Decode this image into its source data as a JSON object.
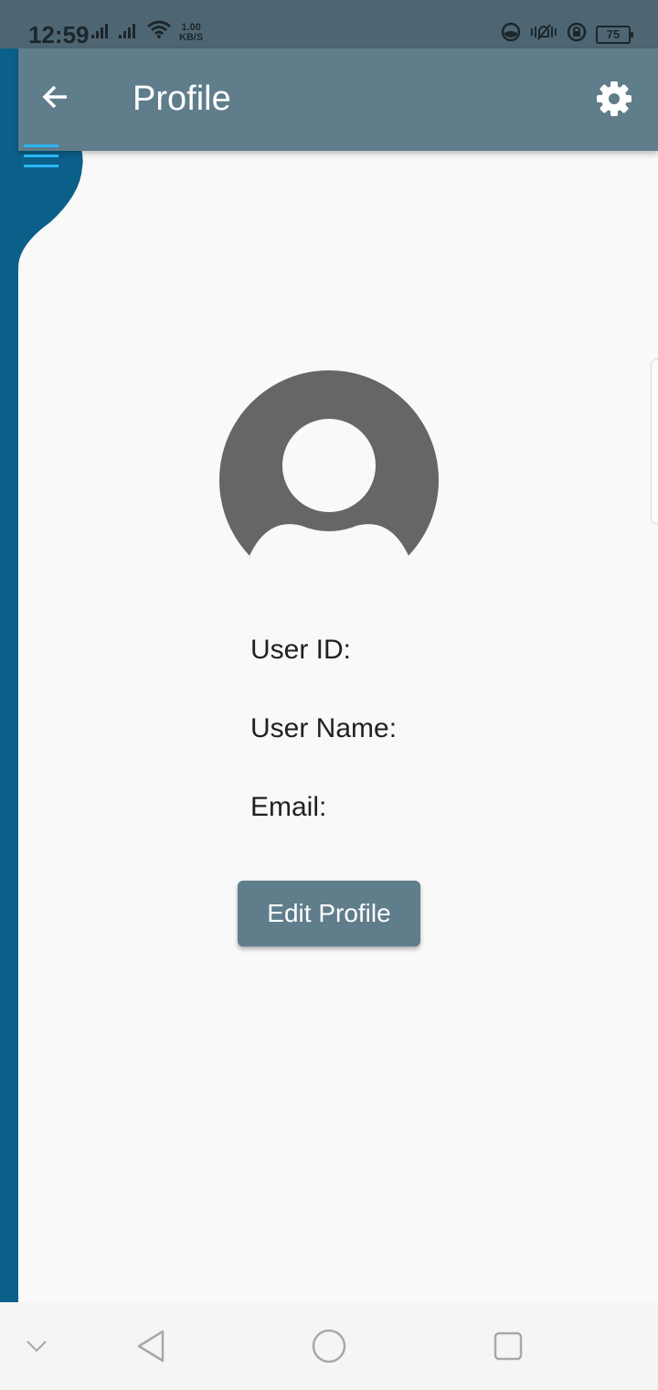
{
  "status_bar": {
    "time": "12:59",
    "net_speed_value": "1.00",
    "net_speed_unit": "KB/S",
    "battery_level": "75",
    "icons": [
      "signal-icon",
      "signal-icon",
      "wifi-icon",
      "data-saver-icon",
      "vibrate-icon",
      "rotation-lock-icon",
      "battery-icon"
    ]
  },
  "app_bar": {
    "title": "Profile",
    "back_icon": "back-arrow-icon",
    "settings_icon": "gear-icon",
    "color": "#607d8b"
  },
  "drawer": {
    "menu_icon": "hamburger-menu-icon",
    "color": "#0b6089",
    "icon_color": "#29b6f6"
  },
  "profile": {
    "avatar_icon": "account-circle-icon",
    "fields": [
      {
        "label": "User ID:"
      },
      {
        "label": "User Name:"
      },
      {
        "label": "Email:"
      }
    ],
    "edit_button_label": "Edit Profile"
  },
  "nav_bar": {
    "icons": [
      "chevron-down-icon",
      "back-triangle-icon",
      "home-circle-icon",
      "recents-square-icon"
    ]
  }
}
